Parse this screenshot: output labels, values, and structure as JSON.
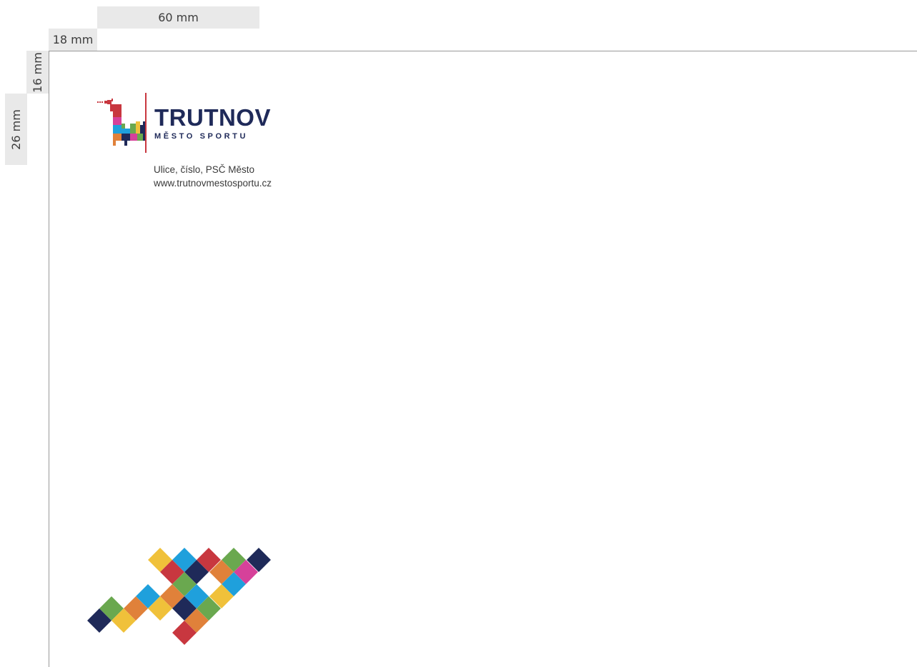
{
  "dimensions": {
    "top_width": "60 mm",
    "left_margin": "18 mm",
    "top_margin": "16 mm",
    "logo_height": "26 mm"
  },
  "logo": {
    "title": "TRUTNOV",
    "subtitle": "MĚSTO SPORTU",
    "colors": {
      "navy": "#1f2a59",
      "red": "#c8373f",
      "orange": "#e0813a",
      "yellow": "#f0c13a",
      "green": "#6aa84f",
      "blue": "#1fa0dc",
      "pink": "#d6419a"
    }
  },
  "address": {
    "line1": "Ulice, číslo, PSČ Město",
    "line2": "www.trutnovmestosportu.cz"
  }
}
